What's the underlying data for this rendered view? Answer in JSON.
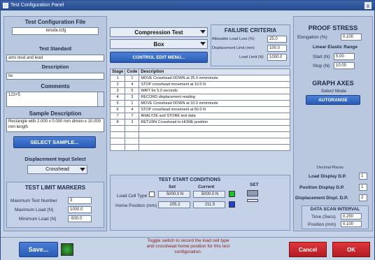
{
  "window": {
    "title": "Test Configuration Panel",
    "close": "x"
  },
  "left": {
    "test_config_file_label": "Test Configuration File",
    "test_config_file_value": "tensile.tcfg",
    "test_standard_label": "Test Standard",
    "test_standard_value": "ams tesd and lead",
    "description_label": "Description",
    "description_value": "tw",
    "comments_label": "Comments",
    "comments_value": "123+5",
    "sample_description_label": "Sample Description",
    "sample_description_value": "Rectangle with 2.000 x 0.000 mm dimen-x 10.000 mm length",
    "select_sample_label": "SELECT SAMPLE...",
    "displacement_input_label": "Displacement Input Select",
    "displacement_input_value": "Crosshead"
  },
  "limits": {
    "title": "TEST LIMIT MARKERS",
    "max_test_number_label": "Maximum Test Number",
    "max_test_number_value": "3",
    "max_load_label": "Maximum Load (N)",
    "max_load_value": "1000.0",
    "min_load_label": "Minimum Load (N)",
    "min_load_value": "-500.0"
  },
  "center": {
    "test_type": "Compression Test",
    "shape": "Box",
    "control_edit_label": "CONTROL EDIT MENU...",
    "failure_title": "FAILURE CRITERIA",
    "allowable_load_loss_label": "Allowable Load Loss (%)",
    "allowable_load_loss_value": "25.0",
    "displacement_limit_label": "Displacement Limit (mm)",
    "displacement_limit_value": "100.0",
    "load_limit_label": "Load Limit (N)",
    "load_limit_value": "1000.0"
  },
  "stages": {
    "headers": [
      "Stage",
      "Code",
      "Description"
    ],
    "rows": [
      [
        "1",
        "1",
        "MOVE Crosshead DOWN at 25.0 mm/minute"
      ],
      [
        "2",
        "4",
        "STOP crosshead movement at 10.0 N"
      ],
      [
        "3",
        "5",
        "WAIT for 5.0 seconds"
      ],
      [
        "4",
        "3",
        "RECORD displacement reading"
      ],
      [
        "5",
        "1",
        "MOVE Crosshead DOWN at 10.0 mm/minute"
      ],
      [
        "6",
        "4",
        "STOP crosshead movement at 50.0 N"
      ],
      [
        "7",
        "7",
        "ANALYZE and STORE test data"
      ],
      [
        "8",
        "3",
        "RETURN Crosshead to HOME position"
      ],
      [
        "",
        "",
        ""
      ],
      [
        "",
        "",
        ""
      ],
      [
        "",
        "",
        ""
      ],
      [
        "",
        "",
        ""
      ]
    ]
  },
  "start": {
    "title": "TEST START CONDITIONS",
    "set_col": "Set",
    "current_col": "Current",
    "set_label": "SET",
    "load_cell_label": "Load Cell Type",
    "load_cell_set": "5000.0 N",
    "load_cell_current": "5000.0 N",
    "home_label": "Home Position (mm)",
    "home_set": "205.2",
    "home_current": "211.5",
    "green_color": "#19c02a",
    "blue_color": "#1e3fd0"
  },
  "proof": {
    "title": "PROOF STRESS",
    "elongation_label": "Elongation (%)",
    "elongation_value": "0.100",
    "linear_range_label": "Linear Elastic Range",
    "start_label": "Start (N)",
    "start_value": "5.00",
    "stop_label": "Stop (N)",
    "stop_value": "10.00"
  },
  "graph": {
    "title": "GRAPH AXES",
    "select_mode": "Select Mode",
    "autorange_label": "AUTORANGE",
    "decimal_header": "Decimal Places",
    "load_dp_label": "Load Display D.P.",
    "load_dp_value": "1",
    "pos_dp_label": "Position Display D.P.",
    "pos_dp_value": "1",
    "disp_dp_label": "Displacement Displ. D.P.",
    "disp_dp_value": "2"
  },
  "scan": {
    "title": "DATA SCAN INTERVAL",
    "time_label": "Time (Secs)",
    "time_value": "0.250",
    "position_label": "Position (mm)",
    "position_value": "0.100"
  },
  "bottom": {
    "save_label": "Save...",
    "tooltip": "Toggle switch to record the load cell type and crosshead home position for this test configuration.",
    "cancel_label": "Cancel",
    "ok_label": "OK"
  }
}
